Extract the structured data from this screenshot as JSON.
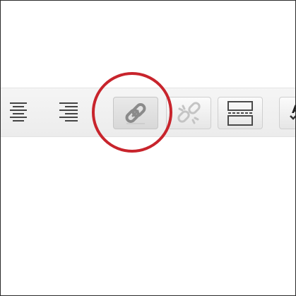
{
  "toolbar": {
    "buttons": [
      {
        "name": "align-center",
        "icon": "align-center-icon",
        "disabled": false
      },
      {
        "name": "align-right",
        "icon": "align-right-icon",
        "disabled": false
      },
      {
        "name": "insert-link",
        "icon": "link-icon",
        "disabled": false,
        "highlighted": true
      },
      {
        "name": "remove-link",
        "icon": "unlink-icon",
        "disabled": true
      },
      {
        "name": "insert-more",
        "icon": "more-break-icon",
        "disabled": false
      },
      {
        "name": "text-format",
        "icon": "text-format-icon",
        "label": "A",
        "disabled": false
      }
    ]
  },
  "annotation": {
    "highlight_color": "#c8242c",
    "target": "insert-link"
  }
}
